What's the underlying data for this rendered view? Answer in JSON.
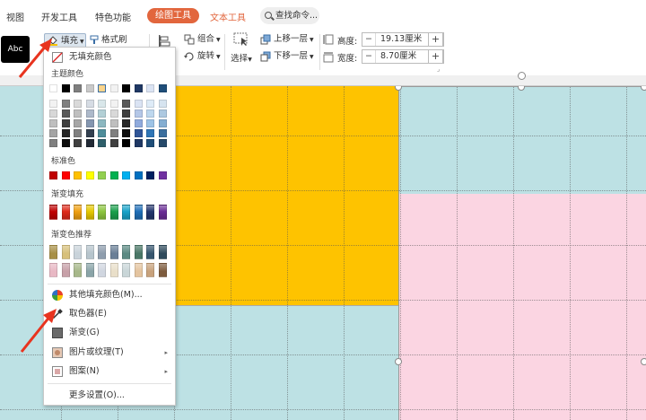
{
  "tabs": [
    {
      "label": "视图",
      "state": "normal"
    },
    {
      "label": "开发工具",
      "state": "normal"
    },
    {
      "label": "特色功能",
      "state": "normal"
    },
    {
      "label": "绘图工具",
      "state": "active"
    },
    {
      "label": "文本工具",
      "state": "orange"
    }
  ],
  "search": {
    "label": "查找命令..."
  },
  "ribbon": {
    "style_preview": "Abc",
    "fill_label": "填充",
    "format_painter_label": "格式刷",
    "group_label": "组合",
    "rotate_label": "旋转",
    "select_label": "选择",
    "bring_forward_label": "上移一层",
    "send_backward_label": "下移一层",
    "height_label": "高度:",
    "height_value": "19.13厘米",
    "width_label": "宽度:",
    "width_value": "8.70厘米"
  },
  "dropdown": {
    "no_fill": "无填充颜色",
    "theme_colors_label": "主题颜色",
    "standard_colors_label": "标准色",
    "gradient_fill_label": "渐变填充",
    "gradient_recommend_label": "渐变色推荐",
    "more_colors": "其他填充颜色(M)...",
    "eyedropper": "取色器(E)",
    "gradient": "渐变(G)",
    "picture_texture": "图片或纹理(T)",
    "pattern": "图案(N)",
    "more_settings": "更多设置(O)..."
  },
  "colors": {
    "accent": "#e2663d",
    "canvas_bg": "#bde1e4",
    "yellow_shape": "#fec300",
    "pink_shape": "#fbd5e2",
    "arrow_red": "#e8341f"
  },
  "theme_top_row": [
    "#ffffff",
    "#000000",
    "#7f7f7f",
    "#c9c9c9",
    "#fbd48b",
    "#f2f2f2",
    "#000000",
    "#1f3864",
    "#dae3f3",
    "#1f4e79"
  ],
  "theme_columns": [
    [
      "#f2f2f2",
      "#d8d8d8",
      "#bfbfbf",
      "#a5a5a5",
      "#7f7f7f"
    ],
    [
      "#7f7f7f",
      "#595959",
      "#3f3f3f",
      "#262626",
      "#0d0d0d"
    ],
    [
      "#d9d9d9",
      "#bfbfbf",
      "#a6a6a6",
      "#808080",
      "#404040"
    ],
    [
      "#d6dce4",
      "#adb9ca",
      "#8496b0",
      "#323f4f",
      "#222a35"
    ],
    [
      "#d9e7ea",
      "#b3d0d6",
      "#8cb8c1",
      "#4e8d9a",
      "#2e5f6a"
    ],
    [
      "#f2f2f2",
      "#d9d9d9",
      "#bfbfbf",
      "#7f7f7f",
      "#404040"
    ],
    [
      "#595959",
      "#404040",
      "#262626",
      "#0d0d0d",
      "#000000"
    ],
    [
      "#dae3f3",
      "#b4c7e7",
      "#8faadc",
      "#2f5597",
      "#1f3864"
    ],
    [
      "#deebf7",
      "#bdd7ee",
      "#9dc3e6",
      "#2e75b6",
      "#1f4e79"
    ],
    [
      "#d6e4f0",
      "#adc9e1",
      "#84aed2",
      "#3b6f9f",
      "#26496a"
    ]
  ],
  "standard_colors": [
    "#c00000",
    "#ff0000",
    "#ffc000",
    "#ffff00",
    "#92d050",
    "#00b050",
    "#00b0f0",
    "#0070c0",
    "#002060",
    "#7030a0"
  ],
  "gradient_colors": [
    "#c00000",
    "#e02a1a",
    "#f0a010",
    "#e6c800",
    "#8cc63e",
    "#1aa04c",
    "#17a3c9",
    "#1f6fb8",
    "#23366e",
    "#6a2d96"
  ],
  "recommend_row1": [
    "#a89046",
    "#d7c07a",
    "#c9d3da",
    "#b6c4cc",
    "#8e9dad",
    "#6a7f97",
    "#5b8a83",
    "#4a7767",
    "#36566e",
    "#2e4a5c"
  ],
  "recommend_row2": [
    "#e8b8c4",
    "#c7a0a8",
    "#a7b88a",
    "#8aa4a8",
    "#d0d6e0",
    "#e9dfc9",
    "#c9d6d8",
    "#e4c49f",
    "#c8a27c",
    "#7e5c3e"
  ]
}
